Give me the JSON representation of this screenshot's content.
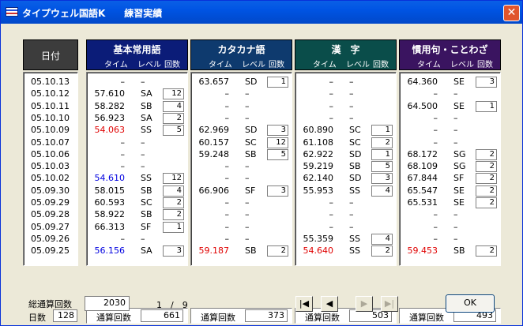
{
  "window": {
    "title": "タイプウェル国語K　　練習実績",
    "close": "✕"
  },
  "date_header": "日付",
  "dates": [
    "05.10.13",
    "05.10.12",
    "05.10.11",
    "05.10.10",
    "05.10.09",
    "05.10.07",
    "05.10.06",
    "05.10.03",
    "05.10.02",
    "05.09.30",
    "05.09.29",
    "05.09.28",
    "05.09.27",
    "05.09.26",
    "05.09.25"
  ],
  "days_label": "日数",
  "days_value": "128",
  "columns": [
    {
      "title": "基本常用語",
      "sub_time": "タイム",
      "sub_level": "レベル",
      "sub_count": "回数",
      "color": "#0b1c78",
      "rows": [
        {
          "t": "–",
          "l": "–",
          "c": "",
          "color": ""
        },
        {
          "t": "57.610",
          "l": "SA",
          "c": "12",
          "color": ""
        },
        {
          "t": "58.282",
          "l": "SB",
          "c": "4",
          "color": ""
        },
        {
          "t": "56.923",
          "l": "SA",
          "c": "2",
          "color": ""
        },
        {
          "t": "54.063",
          "l": "SS",
          "c": "5",
          "color": "red"
        },
        {
          "t": "–",
          "l": "–",
          "c": "",
          "color": ""
        },
        {
          "t": "–",
          "l": "–",
          "c": "",
          "color": ""
        },
        {
          "t": "–",
          "l": "–",
          "c": "",
          "color": ""
        },
        {
          "t": "54.610",
          "l": "SS",
          "c": "12",
          "color": "blue"
        },
        {
          "t": "58.015",
          "l": "SB",
          "c": "4",
          "color": ""
        },
        {
          "t": "60.593",
          "l": "SC",
          "c": "2",
          "color": ""
        },
        {
          "t": "58.922",
          "l": "SB",
          "c": "2",
          "color": ""
        },
        {
          "t": "66.313",
          "l": "SF",
          "c": "1",
          "color": ""
        },
        {
          "t": "–",
          "l": "–",
          "c": "",
          "color": ""
        },
        {
          "t": "56.156",
          "l": "SA",
          "c": "3",
          "color": "blue"
        }
      ],
      "footer_label": "通算回数",
      "footer_value": "661"
    },
    {
      "title": "カタカナ語",
      "sub_time": "タイム",
      "sub_level": "レベル",
      "sub_count": "回数",
      "color": "#0e3a6e",
      "rows": [
        {
          "t": "63.657",
          "l": "SD",
          "c": "1",
          "color": ""
        },
        {
          "t": "–",
          "l": "–",
          "c": "",
          "color": ""
        },
        {
          "t": "–",
          "l": "–",
          "c": "",
          "color": ""
        },
        {
          "t": "–",
          "l": "–",
          "c": "",
          "color": ""
        },
        {
          "t": "62.969",
          "l": "SD",
          "c": "3",
          "color": ""
        },
        {
          "t": "60.157",
          "l": "SC",
          "c": "12",
          "color": ""
        },
        {
          "t": "59.248",
          "l": "SB",
          "c": "5",
          "color": ""
        },
        {
          "t": "–",
          "l": "–",
          "c": "",
          "color": ""
        },
        {
          "t": "–",
          "l": "–",
          "c": "",
          "color": ""
        },
        {
          "t": "66.906",
          "l": "SF",
          "c": "3",
          "color": ""
        },
        {
          "t": "–",
          "l": "–",
          "c": "",
          "color": ""
        },
        {
          "t": "–",
          "l": "–",
          "c": "",
          "color": ""
        },
        {
          "t": "–",
          "l": "–",
          "c": "",
          "color": ""
        },
        {
          "t": "–",
          "l": "–",
          "c": "",
          "color": ""
        },
        {
          "t": "59.187",
          "l": "SB",
          "c": "2",
          "color": "red"
        }
      ],
      "footer_label": "通算回数",
      "footer_value": "373"
    },
    {
      "title": "漢　字",
      "sub_time": "タイム",
      "sub_level": "レベル",
      "sub_count": "回数",
      "color": "#0a4d4a",
      "rows": [
        {
          "t": "–",
          "l": "–",
          "c": "",
          "color": ""
        },
        {
          "t": "–",
          "l": "–",
          "c": "",
          "color": ""
        },
        {
          "t": "–",
          "l": "–",
          "c": "",
          "color": ""
        },
        {
          "t": "–",
          "l": "–",
          "c": "",
          "color": ""
        },
        {
          "t": "60.890",
          "l": "SC",
          "c": "1",
          "color": ""
        },
        {
          "t": "61.108",
          "l": "SC",
          "c": "2",
          "color": ""
        },
        {
          "t": "62.922",
          "l": "SD",
          "c": "1",
          "color": ""
        },
        {
          "t": "59.219",
          "l": "SB",
          "c": "5",
          "color": ""
        },
        {
          "t": "62.140",
          "l": "SD",
          "c": "3",
          "color": ""
        },
        {
          "t": "55.953",
          "l": "SS",
          "c": "4",
          "color": ""
        },
        {
          "t": "–",
          "l": "–",
          "c": "",
          "color": ""
        },
        {
          "t": "–",
          "l": "–",
          "c": "",
          "color": ""
        },
        {
          "t": "–",
          "l": "–",
          "c": "",
          "color": ""
        },
        {
          "t": "55.359",
          "l": "SS",
          "c": "4",
          "color": ""
        },
        {
          "t": "54.640",
          "l": "SS",
          "c": "2",
          "color": "red"
        }
      ],
      "footer_label": "通算回数",
      "footer_value": "503"
    },
    {
      "title": "慣用句・ことわざ",
      "sub_time": "タイム",
      "sub_level": "レベル",
      "sub_count": "回数",
      "color": "#3a1460",
      "rows": [
        {
          "t": "64.360",
          "l": "SE",
          "c": "3",
          "color": ""
        },
        {
          "t": "–",
          "l": "–",
          "c": "",
          "color": ""
        },
        {
          "t": "64.500",
          "l": "SE",
          "c": "1",
          "color": ""
        },
        {
          "t": "–",
          "l": "–",
          "c": "",
          "color": ""
        },
        {
          "t": "–",
          "l": "–",
          "c": "",
          "color": ""
        },
        {
          "t": "–",
          "l": "–",
          "c": "",
          "color": ""
        },
        {
          "t": "68.172",
          "l": "SG",
          "c": "2",
          "color": ""
        },
        {
          "t": "68.109",
          "l": "SG",
          "c": "2",
          "color": ""
        },
        {
          "t": "67.844",
          "l": "SF",
          "c": "2",
          "color": ""
        },
        {
          "t": "65.547",
          "l": "SE",
          "c": "2",
          "color": ""
        },
        {
          "t": "65.531",
          "l": "SE",
          "c": "2",
          "color": ""
        },
        {
          "t": "–",
          "l": "–",
          "c": "",
          "color": ""
        },
        {
          "t": "–",
          "l": "–",
          "c": "",
          "color": ""
        },
        {
          "t": "–",
          "l": "–",
          "c": "",
          "color": ""
        },
        {
          "t": "59.453",
          "l": "SB",
          "c": "2",
          "color": "red"
        }
      ],
      "footer_label": "通算回数",
      "footer_value": "493"
    }
  ],
  "total": {
    "label": "総通算回数",
    "value": "2030"
  },
  "pager": "1　/　9",
  "nav": {
    "first": "|◀",
    "prev": "◀",
    "next": "▶",
    "last": "▶|"
  },
  "ok_label": "OK"
}
